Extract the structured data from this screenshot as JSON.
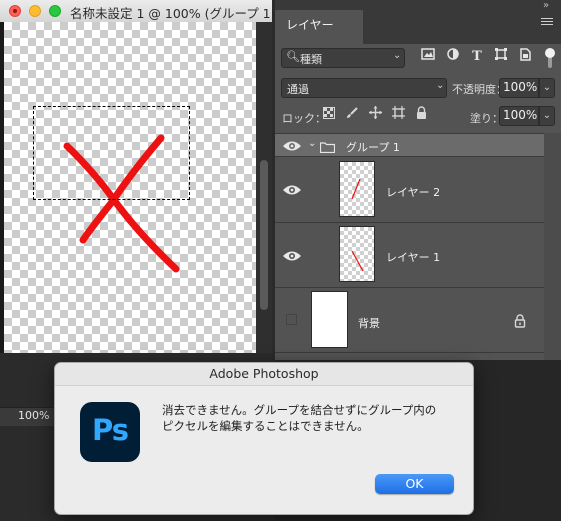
{
  "document": {
    "title": "名称未設定 1 @ 100% (グループ 1...",
    "zoom": "100%"
  },
  "layers_panel": {
    "tab_label": "レイヤー",
    "collapse_glyph": "»",
    "filter": {
      "label": "種類"
    },
    "blend_mode": "通過",
    "opacity_label": "不透明度：",
    "opacity_value": "100%",
    "lock_label": "ロック：",
    "fill_label": "塗り：",
    "fill_value": "100%",
    "layers": [
      {
        "name": "グループ 1",
        "kind": "group",
        "visible": true,
        "expanded": true
      },
      {
        "name": "レイヤー 2",
        "kind": "pixel",
        "visible": true
      },
      {
        "name": "レイヤー 1",
        "kind": "pixel",
        "visible": true
      },
      {
        "name": "背景",
        "kind": "background",
        "visible": false,
        "locked": true
      }
    ]
  },
  "dialog": {
    "title": "Adobe Photoshop",
    "app_icon_text": "Ps",
    "message_line1": "消去できません。グループを結合せずにグループ内の",
    "message_line2": "ピクセルを編集することはできません。",
    "ok_label": "OK"
  },
  "colors": {
    "stroke": "#ee1111",
    "accent": "#1e6fe6",
    "ps_icon_bg": "#001e36",
    "ps_icon_fg": "#31a8ff"
  }
}
